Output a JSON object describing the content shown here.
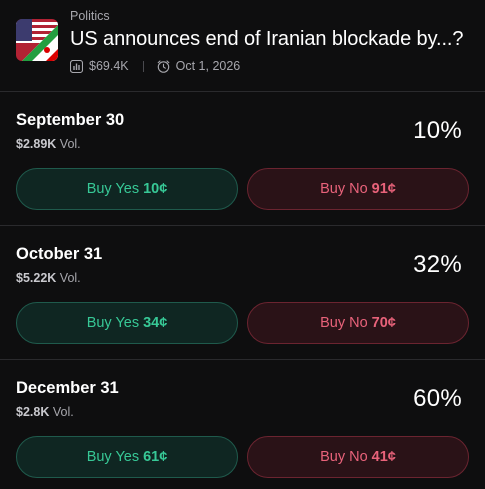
{
  "event": {
    "category": "Politics",
    "title": "US announces end of Iranian blockade by...?",
    "volume": "$69.4K",
    "date": "Oct 1, 2026"
  },
  "markets": [
    {
      "label": "September 30",
      "volume": "$2.89K",
      "vol_suffix": "Vol.",
      "percent": "10%",
      "yes_label": "Buy Yes",
      "yes_price": "10¢",
      "no_label": "Buy No",
      "no_price": "91¢"
    },
    {
      "label": "October 31",
      "volume": "$5.22K",
      "vol_suffix": "Vol.",
      "percent": "32%",
      "yes_label": "Buy Yes",
      "yes_price": "34¢",
      "no_label": "Buy No",
      "no_price": "70¢"
    },
    {
      "label": "December 31",
      "volume": "$2.8K",
      "vol_suffix": "Vol.",
      "percent": "60%",
      "yes_label": "Buy Yes",
      "yes_price": "61¢",
      "no_label": "Buy No",
      "no_price": "41¢"
    }
  ],
  "colors": {
    "background": "#0e0e0f",
    "yes_text": "#37c896",
    "no_text": "#e8627a"
  },
  "icons": [
    "flags-thumbnail",
    "chart-icon",
    "clock-icon"
  ]
}
